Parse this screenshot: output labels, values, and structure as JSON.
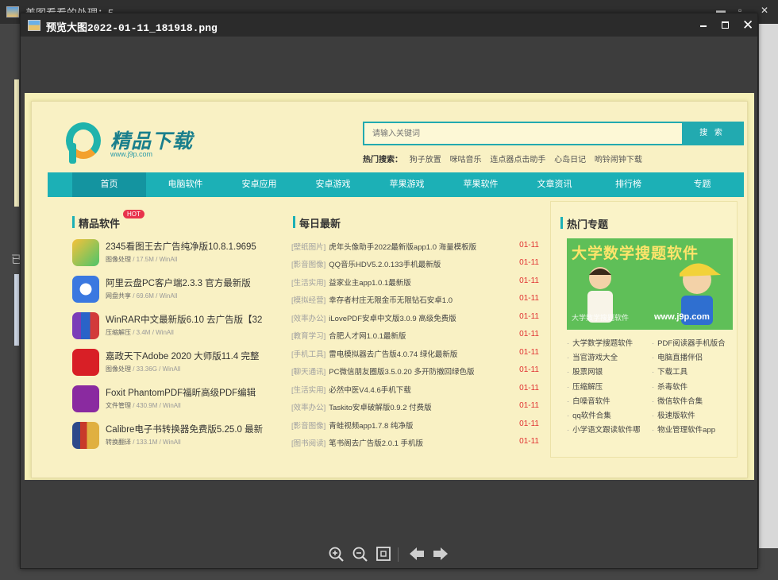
{
  "background_window": {
    "title": "美图看看的处理：5"
  },
  "background_char": "已",
  "viewer": {
    "title": "预览大图2022-01-11_181918.png",
    "controls": {
      "minimize": "minimize",
      "maximize": "maximize",
      "close": "close"
    },
    "toolbar": [
      "zoom-in-icon",
      "zoom-out-icon",
      "fit-window-icon",
      "previous-icon",
      "next-icon"
    ]
  },
  "site": {
    "logo_name": "精品下载",
    "logo_url": "www.j9p.com",
    "search_placeholder": "请输入关键词",
    "search_button": "搜 索",
    "hot_search_label": "热门搜索：",
    "hot_search": [
      "狗子放置",
      "咪咕音乐",
      "连点器点击助手",
      "心岛日记",
      "哟铃闹钟下载"
    ],
    "nav": [
      "首页",
      "电脑软件",
      "安卓应用",
      "安卓游戏",
      "苹果游戏",
      "苹果软件",
      "文章资讯",
      "排行榜",
      "专题"
    ],
    "section_software": "精品软件",
    "hot_badge": "HOT",
    "software": [
      {
        "title": "2345看图王去广告纯净版10.8.1.9695",
        "category": "图像处理",
        "size": "17.5M",
        "platform": "WinAll"
      },
      {
        "title": "阿里云盘PC客户端2.3.3 官方最新版",
        "category": "网盘共享",
        "size": "69.6M",
        "platform": "WinAll"
      },
      {
        "title": "WinRAR中文最新版6.10 去广告版【32",
        "category": "压缩解压",
        "size": "3.4M",
        "platform": "WinAll"
      },
      {
        "title": "嘉政天下Adobe 2020 大师版11.4 完整",
        "category": "图像处理",
        "size": "33.36G",
        "platform": "WinAll"
      },
      {
        "title": "Foxit PhantomPDF福昕高级PDF编辑",
        "category": "文件管理",
        "size": "430.9M",
        "platform": "WinAll"
      },
      {
        "title": "Calibre电子书转换器免费版5.25.0 最新",
        "category": "转换翻译",
        "size": "133.1M",
        "platform": "WinAll"
      }
    ],
    "section_daily": "每日最新",
    "daily": [
      {
        "cat": "[壁纸图片]",
        "title": "虎年头像助手2022最新版app1.0 海量模板版",
        "date": "01-11"
      },
      {
        "cat": "[影音图像]",
        "title": "QQ音乐HDV5.2.0.133手机最新版",
        "date": "01-11"
      },
      {
        "cat": "[生活实用]",
        "title": "益家业主app1.0.1最新版",
        "date": "01-11"
      },
      {
        "cat": "[模拟经营]",
        "title": "幸存者村庄无限金币无限钻石安卓1.0",
        "date": "01-11"
      },
      {
        "cat": "[效率办公]",
        "title": "iLovePDF安卓中文版3.0.9 高级免费版",
        "date": "01-11"
      },
      {
        "cat": "[教育学习]",
        "title": "合肥人才网1.0.1最新版",
        "date": "01-11"
      },
      {
        "cat": "[手机工具]",
        "title": "雷电模拟器去广告版4.0.74 绿化最新版",
        "date": "01-11"
      },
      {
        "cat": "[聊天通讯]",
        "title": "PC微信朋友圈版3.5.0.20 多开防撤回绿色版",
        "date": "01-11"
      },
      {
        "cat": "[生活实用]",
        "title": "必然中医V4.4.6手机下载",
        "date": "01-11"
      },
      {
        "cat": "[效率办公]",
        "title": "Taskito安卓破解版0.9.2 付费版",
        "date": "01-11"
      },
      {
        "cat": "[影音图像]",
        "title": "青蛙视频app1.7.8 纯净版",
        "date": "01-11"
      },
      {
        "cat": "[图书阅读]",
        "title": "笔书阁去广告版2.0.1 手机版",
        "date": "01-11"
      }
    ],
    "section_topics": "热门专题",
    "banner_title": "大学数学搜题软件",
    "banner_caption": "大学数学搜题软件",
    "banner_url": "www.j9p.com",
    "topics": [
      "大学数学搜题软件",
      "PDF阅读器手机版合",
      "当官游戏大全",
      "电脑直播伴侣",
      "股票网银",
      "下载工具",
      "压缩解压",
      "杀毒软件",
      "白噪音软件",
      "微信软件合集",
      "qq软件合集",
      "极速版软件",
      "小学语文跟读软件哪",
      "物业管理软件app"
    ]
  },
  "colors": {
    "accent": "#1cb0b6",
    "date_red": "#e03030",
    "page_bg": "#f9f1c4",
    "hot_badge": "#e8334c"
  }
}
